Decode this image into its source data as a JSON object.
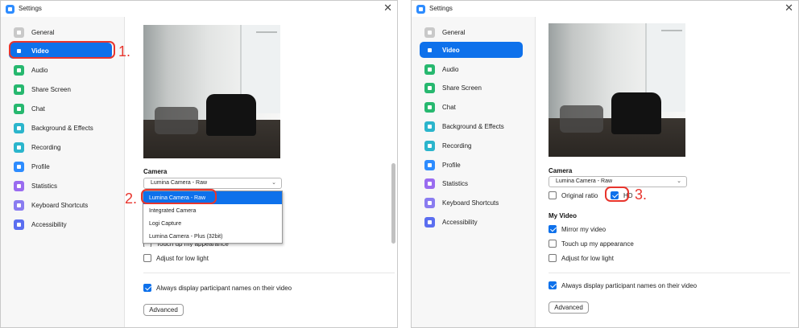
{
  "window": {
    "title": "Settings",
    "close_glyph": "✕"
  },
  "sidebar": {
    "items": [
      {
        "label": "General",
        "icon": "gear-icon",
        "color": "#c9c9c9"
      },
      {
        "label": "Video",
        "icon": "video-camera-icon",
        "color": "#ffffff"
      },
      {
        "label": "Audio",
        "icon": "headphones-icon",
        "color": "#27b86f"
      },
      {
        "label": "Share Screen",
        "icon": "share-screen-icon",
        "color": "#27b86f"
      },
      {
        "label": "Chat",
        "icon": "chat-bubble-icon",
        "color": "#27b86f"
      },
      {
        "label": "Background & Effects",
        "icon": "background-person-icon",
        "color": "#2bb5cc"
      },
      {
        "label": "Recording",
        "icon": "record-icon",
        "color": "#2bb5cc"
      },
      {
        "label": "Profile",
        "icon": "person-icon",
        "color": "#2d8cff"
      },
      {
        "label": "Statistics",
        "icon": "bar-chart-icon",
        "color": "#9a6cf0"
      },
      {
        "label": "Keyboard Shortcuts",
        "icon": "keyboard-icon",
        "color": "#8a7cf0"
      },
      {
        "label": "Accessibility",
        "icon": "accessibility-icon",
        "color": "#5b6ef0"
      }
    ]
  },
  "camera": {
    "section_label": "Camera",
    "selected": "Lumina Camera - Raw",
    "chevron": "⌄",
    "options": [
      "Lumina Camera - Raw",
      "Integrated Camera",
      "Logi Capture",
      "Lumina Camera - Plus (32bit)"
    ]
  },
  "checks": {
    "original_ratio": "Original ratio",
    "hd": "HD",
    "my_video_label": "My Video",
    "mirror": "Mirror my video",
    "touch_up": "Touch up my appearance",
    "touch_up_partial": "Touch up my appearance",
    "low_light": "Adjust for low light",
    "always_display": "Always display participant names on their video"
  },
  "advanced_label": "Advanced",
  "annotations": [
    "1.",
    "2.",
    "3."
  ],
  "colors": {
    "accent": "#0e71eb",
    "annotation": "#e8352d"
  }
}
